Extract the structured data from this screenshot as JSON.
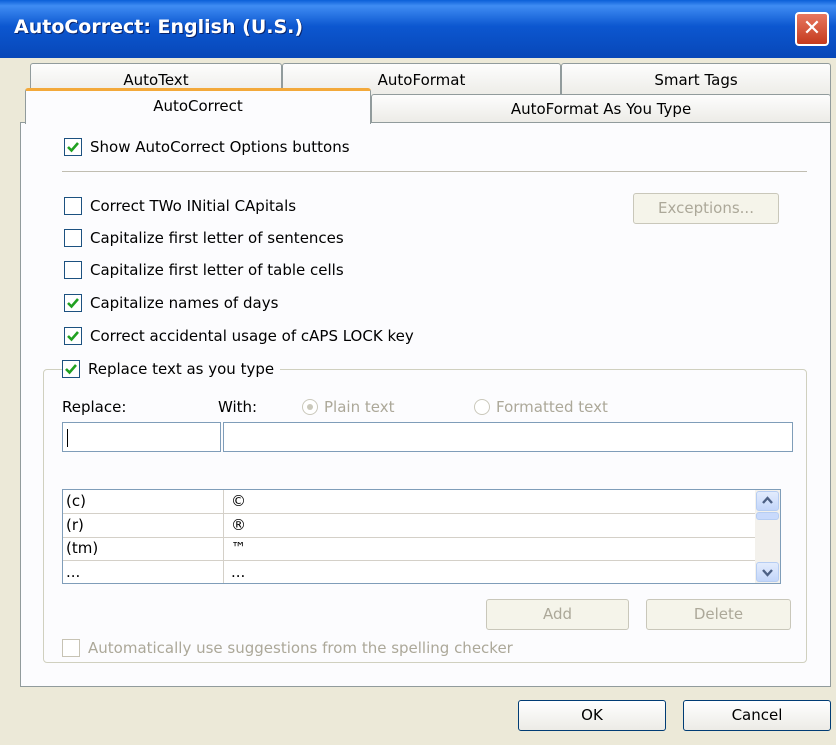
{
  "window": {
    "title": "AutoCorrect: English (U.S.)",
    "close_glyph": "✕"
  },
  "tabs_back": [
    "AutoText",
    "AutoFormat",
    "Smart Tags"
  ],
  "tabs_front": [
    "AutoCorrect",
    "AutoFormat As You Type"
  ],
  "active_tab": "AutoCorrect",
  "options": {
    "show_buttons": {
      "label": "Show AutoCorrect Options buttons",
      "checked": true
    },
    "two_initial": {
      "label": "Correct TWo INitial CApitals",
      "checked": false
    },
    "cap_sentences": {
      "label": "Capitalize first letter of sentences",
      "checked": false
    },
    "cap_table": {
      "label": "Capitalize first letter of table cells",
      "checked": false
    },
    "cap_days": {
      "label": "Capitalize names of days",
      "checked": true
    },
    "caps_lock": {
      "label": "Correct accidental usage of cAPS LOCK key",
      "checked": true
    },
    "replace_text": {
      "label": "Replace text as you type",
      "checked": true
    },
    "spelling": {
      "label": "Automatically use suggestions from the spelling checker",
      "checked": false
    }
  },
  "buttons": {
    "exceptions": "Exceptions...",
    "add": "Add",
    "delete": "Delete",
    "ok": "OK",
    "cancel": "Cancel"
  },
  "replace": {
    "replace_label": "Replace:",
    "with_label": "With:",
    "plain_text": "Plain text",
    "formatted_text": "Formatted text",
    "replace_value": "",
    "with_value": ""
  },
  "entries": [
    {
      "replace": "(c)",
      "with": "©"
    },
    {
      "replace": "(r)",
      "with": "®"
    },
    {
      "replace": "(tm)",
      "with": "™"
    },
    {
      "replace": "...",
      "with": "..."
    }
  ],
  "colors": {
    "titlebar": "#0c57d0",
    "dialog": "#ece9d8",
    "tab_highlight": "#f3a93b",
    "check": "#21a121"
  }
}
